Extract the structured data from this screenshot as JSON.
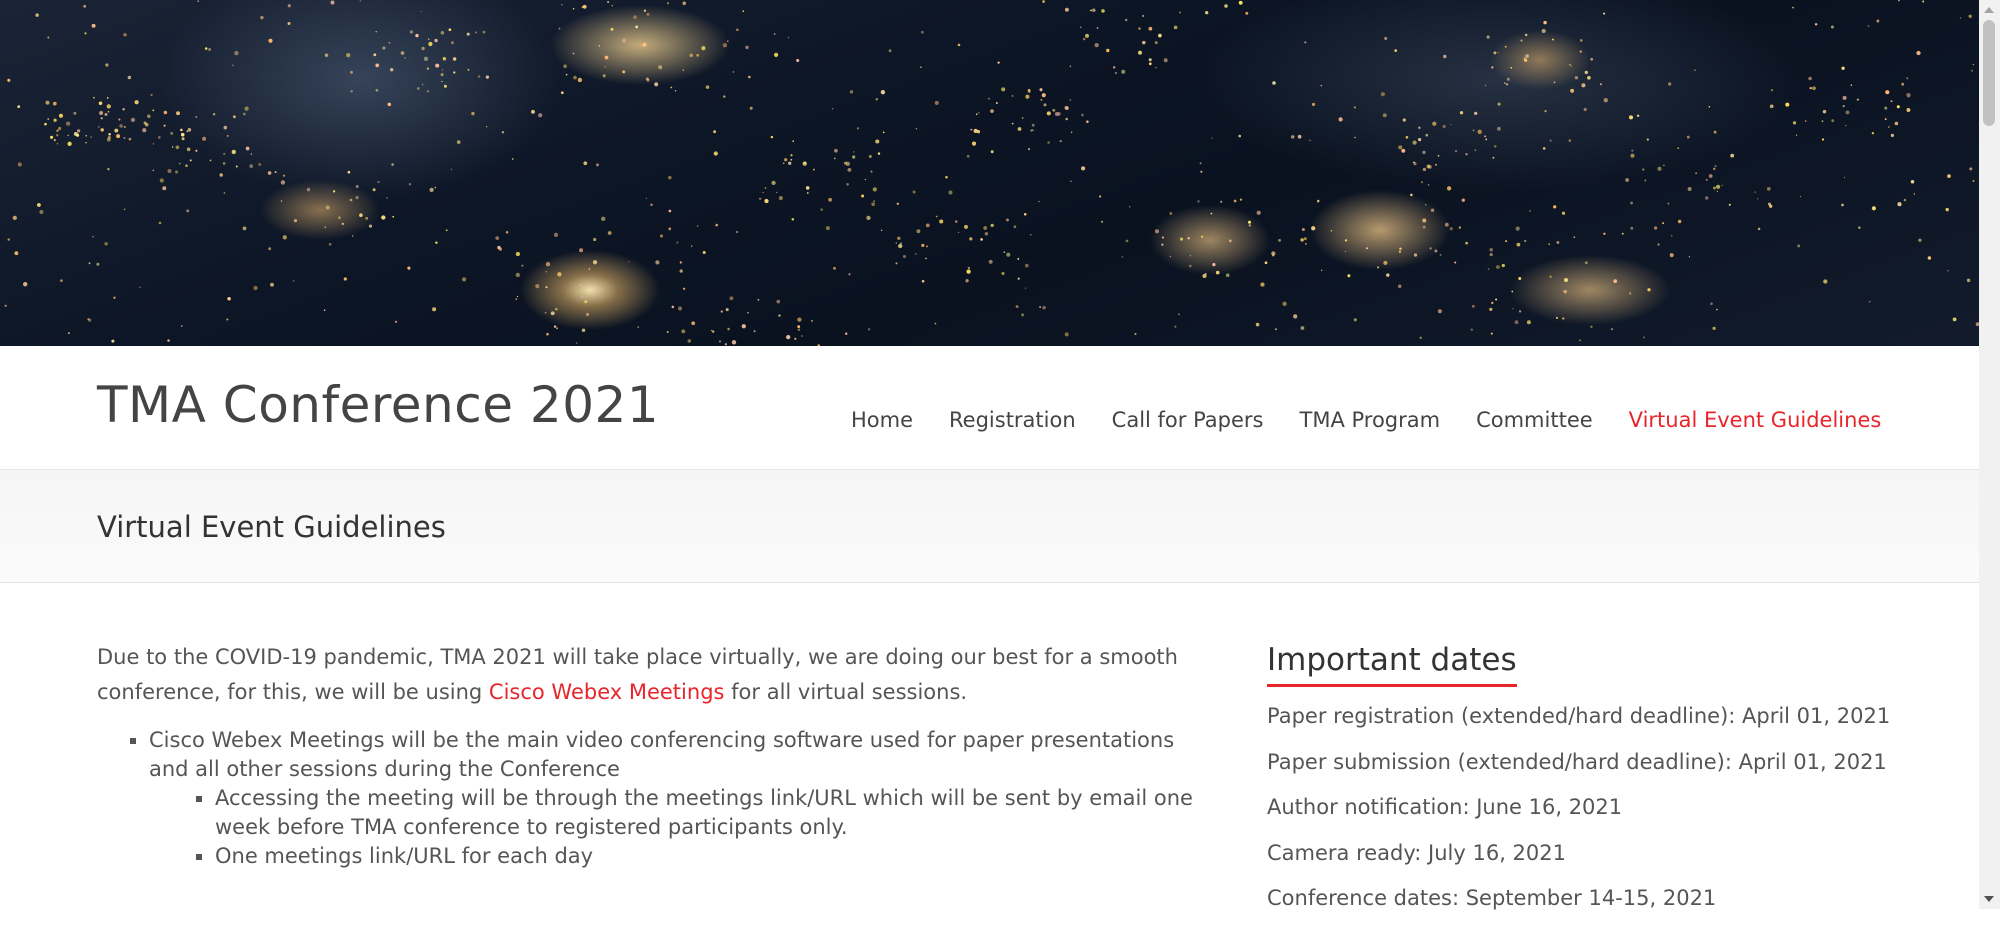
{
  "site": {
    "title": "TMA Conference 2021"
  },
  "nav": {
    "items": [
      "Home",
      "Registration",
      "Call for Papers",
      "TMA Program",
      "Committee",
      "Virtual Event Guidelines"
    ],
    "active": "Virtual Event Guidelines"
  },
  "page": {
    "title": "Virtual Event Guidelines"
  },
  "content": {
    "intro_before": "Due to the COVID-19 pandemic, TMA 2021 will take place virtually, we are doing our best for a smooth conference, for this, we will be using ",
    "intro_link": "Cisco Webex Meetings",
    "intro_after": " for all virtual sessions.",
    "bullet_1": "Cisco Webex Meetings will be the main video conferencing software used for paper presentations and all other sessions during the Conference",
    "sub_bullets": [
      "Accessing the meeting will be through the meetings link/URL which will be sent by email one week before TMA conference to registered participants only.",
      "One meetings link/URL for each day"
    ]
  },
  "sidebar": {
    "widget_title": "Important dates",
    "dates": [
      "Paper registration (extended/hard deadline): April 01, 2021",
      "Paper submission (extended/hard deadline): April 01, 2021",
      "Author notification: June 16, 2021",
      "Camera ready: July 16, 2021",
      "Conference dates: September 14-15, 2021"
    ]
  },
  "colors": {
    "accent": "#e8252b",
    "text": "#555555",
    "heading": "#444444"
  }
}
